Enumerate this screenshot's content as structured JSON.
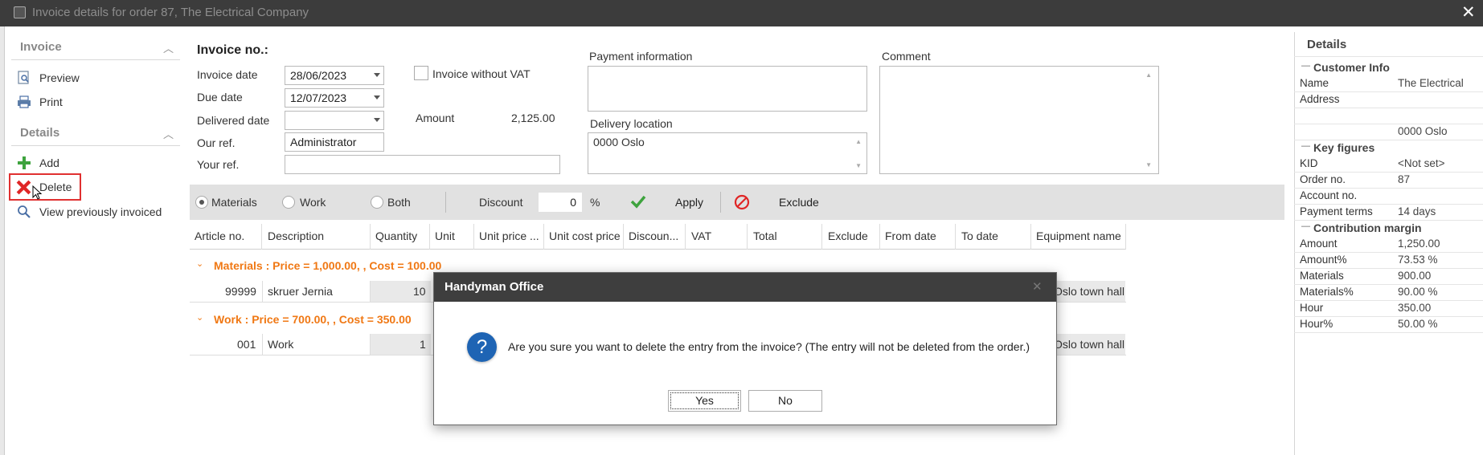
{
  "window": {
    "title": "Invoice details for order 87, The Electrical Company",
    "close_glyph": "✕"
  },
  "sidebar": {
    "invoice_group": "Invoice",
    "details_group": "Details",
    "items": {
      "preview": "Preview",
      "print": "Print",
      "add": "Add",
      "delete": "Delete",
      "view_prev": "View previously invoiced"
    }
  },
  "form": {
    "heading": "Invoice no.:",
    "invoice_date_label": "Invoice date",
    "invoice_date": "28/06/2023",
    "due_date_label": "Due date",
    "due_date": "12/07/2023",
    "delivered_date_label": "Delivered date",
    "delivered_date": "",
    "our_ref_label": "Our ref.",
    "our_ref": "Administrator",
    "your_ref_label": "Your ref.",
    "your_ref": "",
    "without_vat_label": "Invoice without VAT",
    "amount_label": "Amount",
    "amount": "2,125.00",
    "payment_info_label": "Payment information",
    "delivery_location_label": "Delivery location",
    "delivery_location": "0000 Oslo",
    "comment_label": "Comment"
  },
  "filter": {
    "materials": "Materials",
    "work": "Work",
    "both": "Both",
    "discount_label": "Discount",
    "discount_value": "0",
    "percent": "%",
    "apply": "Apply",
    "exclude": "Exclude"
  },
  "grid": {
    "headers": [
      "Article no.",
      "Description",
      "Quantity",
      "Unit",
      "Unit price ...",
      "Unit cost price",
      "Discoun...",
      "VAT",
      "Total",
      "Exclude",
      "From date",
      "To date",
      "Equipment name"
    ],
    "group1": "Materials : Price = 1,000.00, , Cost = 100.00",
    "row1": {
      "article": "99999",
      "description": "skruer Jernia",
      "quantity": "10",
      "equipment": "Oslo town hall"
    },
    "group2": "Work : Price = 700.00, , Cost = 350.00",
    "row2": {
      "article": "001",
      "description": "Work",
      "quantity": "1",
      "equipment": "Oslo town hall"
    }
  },
  "details_panel": {
    "title": "Details",
    "customer_info": "Customer Info",
    "name_label": "Name",
    "name": "The Electrical",
    "address_label": "Address",
    "address_city": "0000 Oslo",
    "key_figures": "Key figures",
    "kid_label": "KID",
    "kid": "<Not set>",
    "order_no_label": "Order no.",
    "order_no": "87",
    "account_no_label": "Account no.",
    "payment_terms_label": "Payment terms",
    "payment_terms": "14 days",
    "contribution_margin": "Contribution margin",
    "amount_label": "Amount",
    "amount": "1,250.00",
    "amount_pct_label": "Amount%",
    "amount_pct": "73.53 %",
    "materials_label": "Materials",
    "materials": "900.00",
    "materials_pct_label": "Materials%",
    "materials_pct": "90.00 %",
    "hour_label": "Hour",
    "hour": "350.00",
    "hour_pct_label": "Hour%",
    "hour_pct": "50.00 %"
  },
  "dialog": {
    "title": "Handyman Office",
    "message": "Are you sure you want to delete the entry from the invoice? (The entry will not be deleted from the order.)",
    "yes": "Yes",
    "no": "No",
    "close_glyph": "✕",
    "icon_glyph": "?"
  },
  "colors": {
    "titlebar": "#3c3c3c",
    "group_text": "#f07814",
    "highlight_border": "#e03030",
    "dialog_icon": "#1e64b4"
  }
}
